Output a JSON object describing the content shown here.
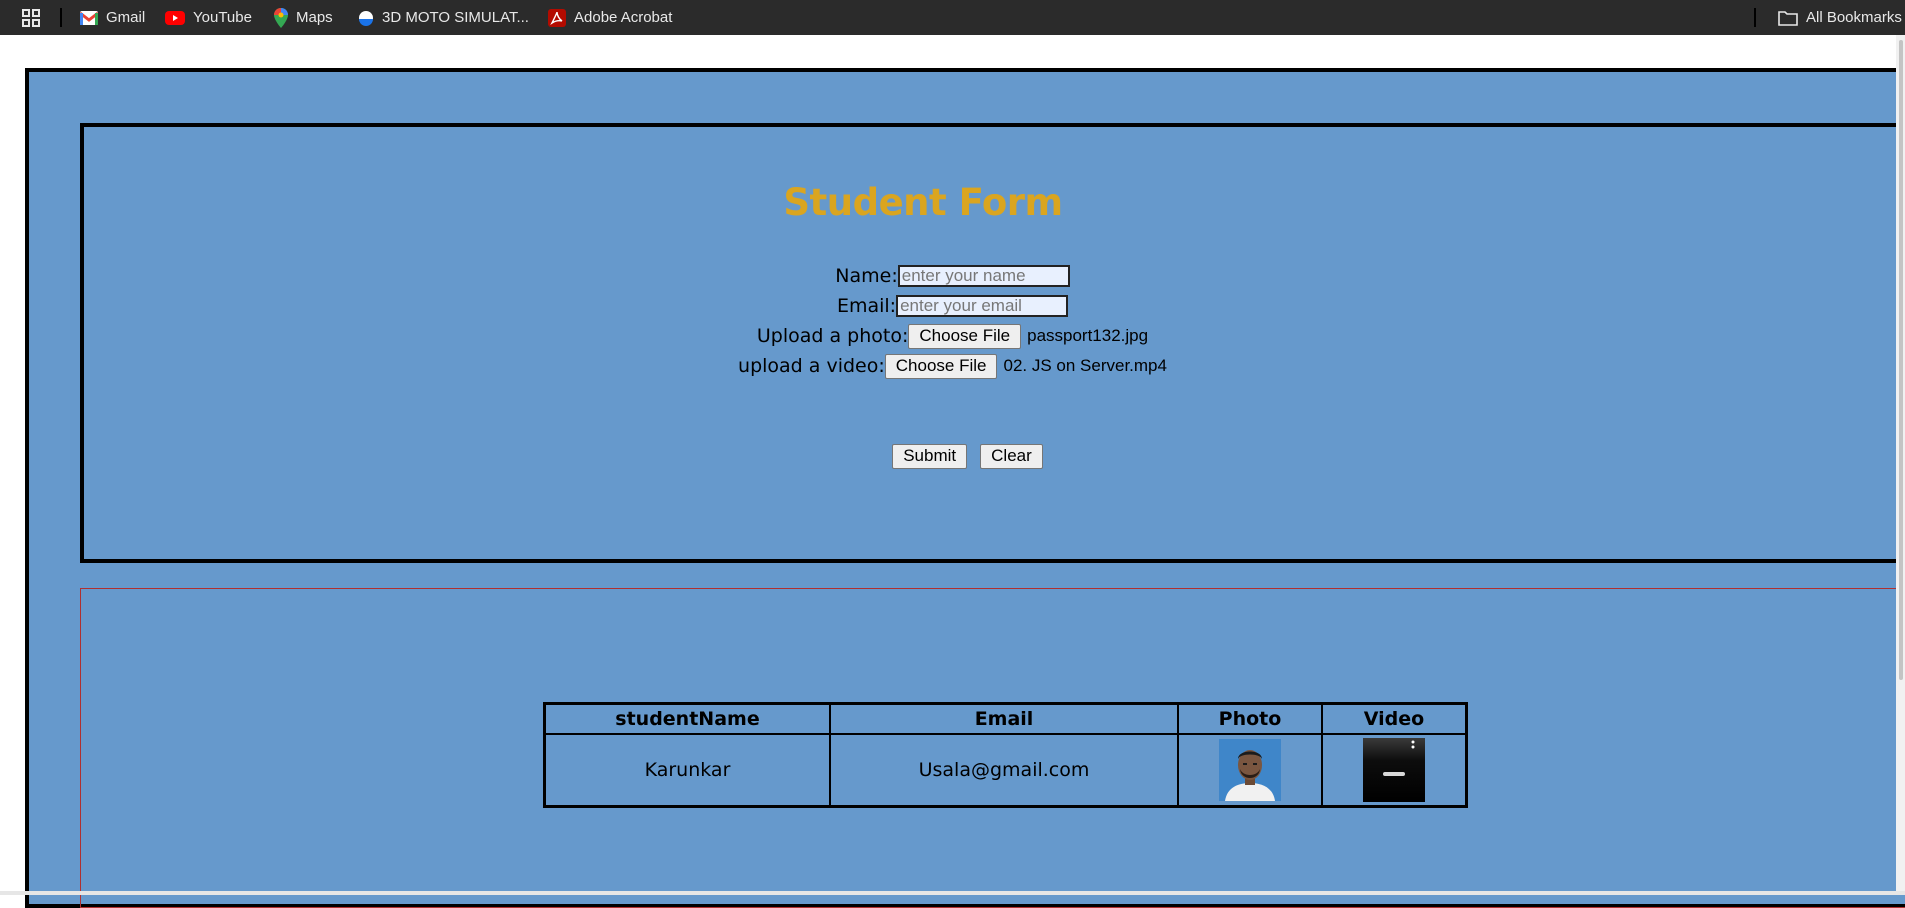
{
  "bookmarks": {
    "items": [
      {
        "label": "Gmail",
        "icon": "gmail-icon"
      },
      {
        "label": "YouTube",
        "icon": "youtube-icon"
      },
      {
        "label": "Maps",
        "icon": "maps-icon"
      },
      {
        "label": "3D MOTO SIMULAT...",
        "icon": "moto-icon"
      },
      {
        "label": "Adobe Acrobat",
        "icon": "acrobat-icon"
      }
    ],
    "all_bookmarks": "All Bookmarks"
  },
  "form": {
    "title": "Student Form",
    "name_label": "Name:",
    "name_placeholder": "enter your name",
    "email_label": "Email:",
    "email_placeholder": "enter your email",
    "photo_label": "Upload a photo:",
    "photo_button": "Choose File",
    "photo_file": "passport132.jpg",
    "video_label": "upload a video:",
    "video_button": "Choose File",
    "video_file": "02. JS on Server.mp4",
    "submit_label": "Submit",
    "clear_label": "Clear"
  },
  "table": {
    "headers": [
      "studentName",
      "Email",
      "Photo",
      "Video"
    ],
    "rows": [
      {
        "studentName": "Karunkar",
        "email": "Usala@gmail.com"
      }
    ]
  },
  "colors": {
    "page_bg": "#6699cc",
    "title": "#daa520",
    "bookmarks_bar": "#2b2b2b"
  }
}
